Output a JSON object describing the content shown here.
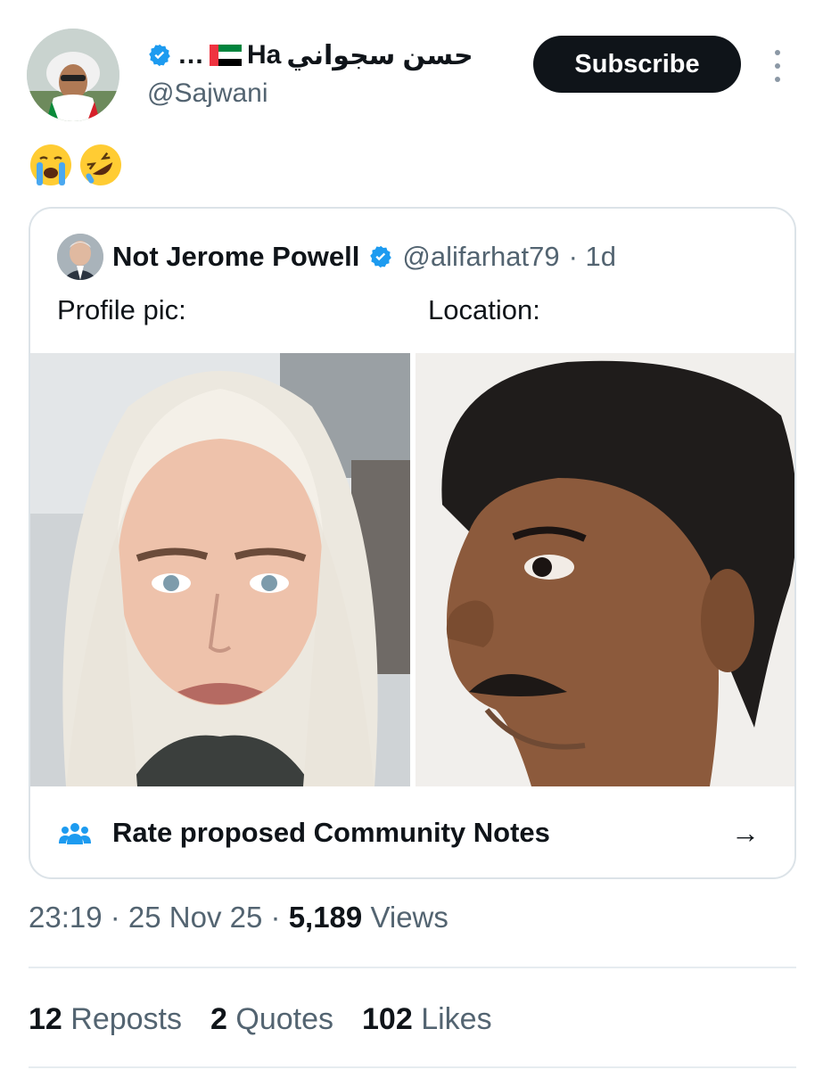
{
  "author": {
    "display_name": "حسن سجواني Ha…",
    "display_name_prefix": "…",
    "display_name_ha": "Ha",
    "display_name_arabic": "حسن سجواني",
    "handle": "@Sajwani",
    "avatar_icon": "user-avatar-photo",
    "verified_icon": "verified-badge-icon",
    "flag_icon": "uae-flag-icon"
  },
  "subscribe_label": "Subscribe",
  "post_text_emojis": [
    "😭",
    "🤣"
  ],
  "quoted": {
    "name": "Not Jerome Powell",
    "handle": "@alifarhat79",
    "time": "· 1d",
    "left_caption": "Profile pic:",
    "right_caption": "Location:",
    "left_image_icon": "photo-woman-platinum-hair",
    "right_image_icon": "photo-man-profile"
  },
  "community_notes": {
    "label": "Rate proposed Community Notes",
    "arrow": "→",
    "icon": "people-icon"
  },
  "meta": {
    "time": "23:19",
    "sep1": " · ",
    "date": "25 Nov 25",
    "sep2": " · ",
    "views_count": "5,189",
    "views_label": " Views"
  },
  "stats": {
    "reposts_count": "12",
    "reposts_label": " Reposts",
    "quotes_count": "2",
    "quotes_label": " Quotes",
    "likes_count": "102",
    "likes_label": " Likes"
  },
  "colors": {
    "verified": "#1d9bf0",
    "text": "#0f1419",
    "secondary": "#536471",
    "border": "#dce3e8"
  }
}
